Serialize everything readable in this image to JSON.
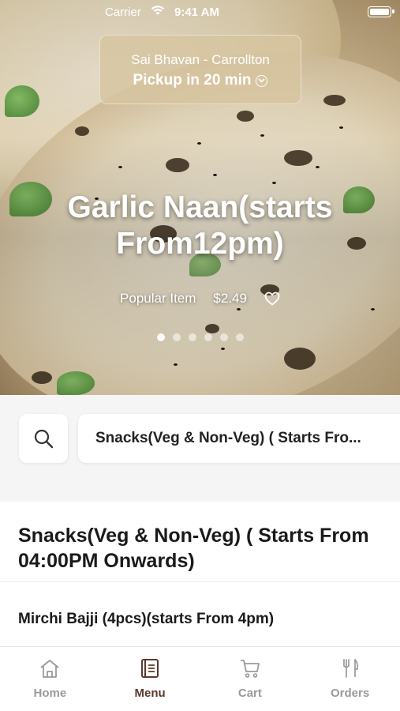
{
  "status_bar": {
    "carrier": "Carrier",
    "time": "9:41 AM"
  },
  "pickup": {
    "location": "Sai Bhavan - Carrollton",
    "time_label": "Pickup in 20 min"
  },
  "hero": {
    "title": "Garlic Naan(starts From12pm)",
    "tag": "Popular Item",
    "price": "$2.49",
    "slide_count": 6,
    "active_slide": 1
  },
  "filter": {
    "category": "Snacks(Veg & Non-Veg) ( Starts Fro..."
  },
  "section": {
    "title": "Snacks(Veg & Non-Veg) ( Starts From 04:00PM Onwards)"
  },
  "items": [
    {
      "name": "Mirchi Bajji (4pcs)(starts From 4pm)"
    }
  ],
  "tabs": [
    {
      "label": "Home",
      "icon": "home-icon",
      "active": false
    },
    {
      "label": "Menu",
      "icon": "menu-book-icon",
      "active": true
    },
    {
      "label": "Cart",
      "icon": "cart-icon",
      "active": false
    },
    {
      "label": "Orders",
      "icon": "fork-knife-icon",
      "active": false
    }
  ],
  "colors": {
    "accent": "#5b3a2e",
    "inactive_tab": "#9a9a9a"
  }
}
